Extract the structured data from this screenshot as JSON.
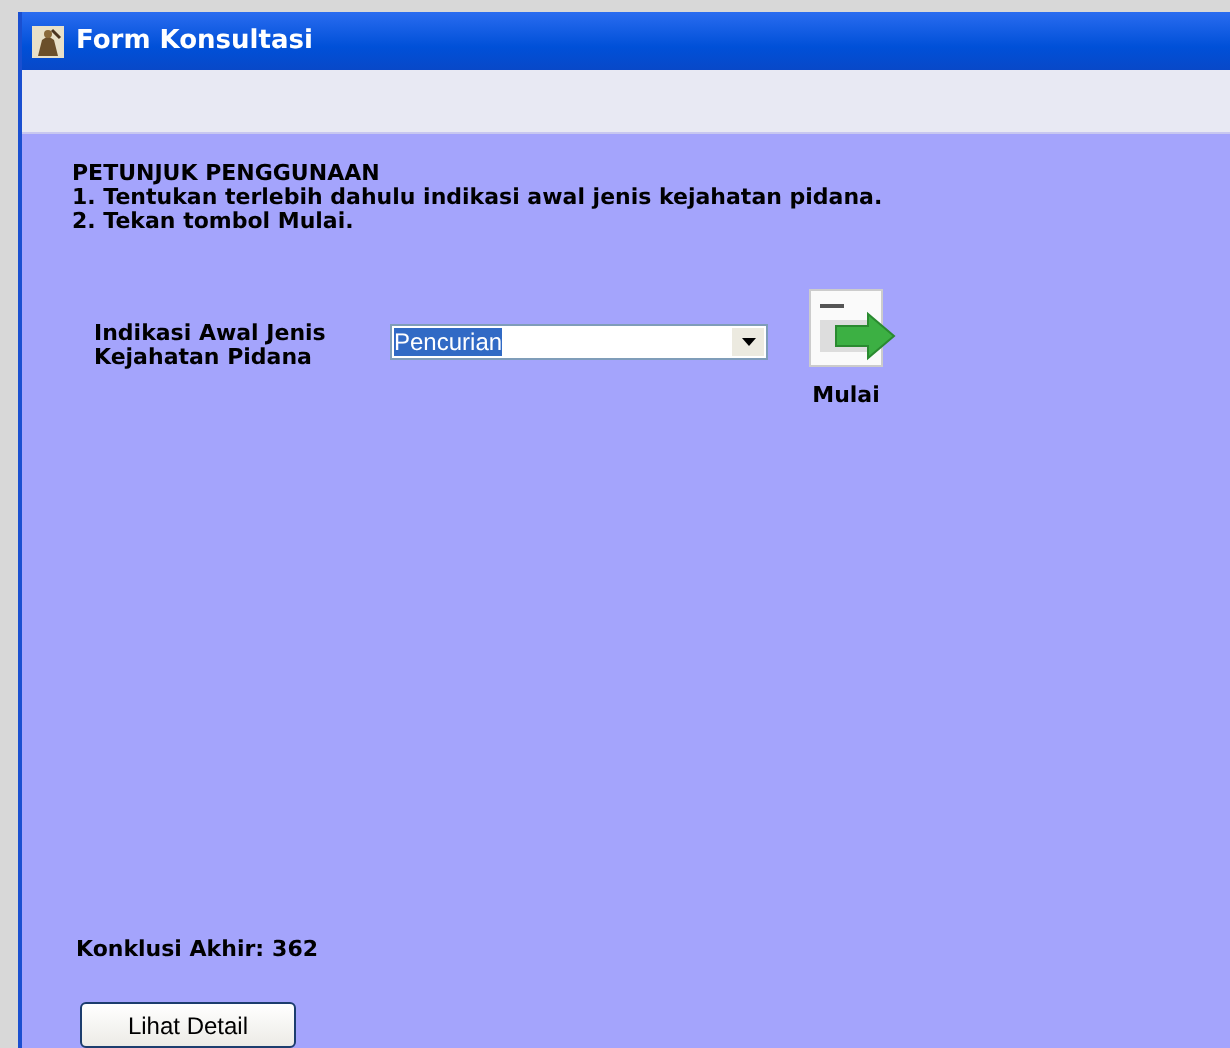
{
  "window": {
    "title": "Form Konsultasi"
  },
  "instructions": {
    "heading": "PETUNJUK PENGGUNAAN",
    "steps": [
      "1. Tentukan terlebih dahulu indikasi awal jenis kejahatan pidana.",
      "2. Tekan tombol Mulai."
    ]
  },
  "indication": {
    "label_lines": [
      "Indikasi Awal Jenis",
      "Kejahatan Pidana"
    ],
    "value": "Pencurian",
    "value_highlighted": true
  },
  "start_button": {
    "label": "Mulai"
  },
  "conclusion": {
    "label": "Konklusi Akhir:",
    "value": "362"
  },
  "detail_button": {
    "label": "Lihat Detail"
  }
}
